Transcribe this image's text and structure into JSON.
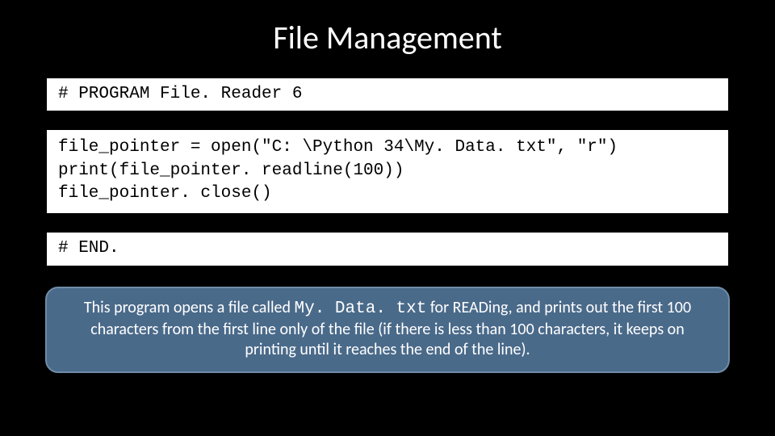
{
  "slide": {
    "title": "File Management",
    "code_block_1": "# PROGRAM File. Reader 6",
    "code_block_2_line_1": "file_pointer = open(\"C: \\Python 34\\My. Data. txt\", \"r\")",
    "code_block_2_line_2": "print(file_pointer. readline(100))",
    "code_block_2_line_3": "file_pointer. close()",
    "code_block_3": "# END.",
    "description_pre": "This program opens a file called ",
    "description_filename": "My. Data. txt",
    "description_post": " for READing, and prints out the first 100 characters from the first line only of the file (if there is less than 100 characters, it keeps on printing until it reaches the end of the line)."
  }
}
